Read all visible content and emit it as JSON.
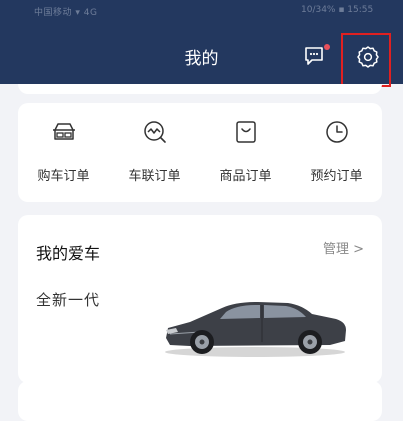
{
  "status_bar": {
    "left_text": "中国移动 ▾ 4G",
    "right_text": "10/34% ▪ 15:55"
  },
  "header": {
    "title": "我的"
  },
  "icons": {
    "message": "message-icon",
    "settings": "gear-icon",
    "car_order": "car-icon",
    "connected_order": "connected-car-icon",
    "goods_order": "shopping-bag-icon",
    "appointment_order": "clock-icon",
    "manage_chevron": "chevron-right-icon"
  },
  "colors": {
    "header_bg": "#23385f",
    "page_bg": "#f2f3f7",
    "highlight": "#e02020",
    "badge": "#e8505b"
  },
  "orders": [
    {
      "label": "购车订单"
    },
    {
      "label": "车联订单"
    },
    {
      "label": "商品订单"
    },
    {
      "label": "预约订单"
    }
  ],
  "my_car": {
    "title": "我的爱车",
    "manage_label": "管理 >",
    "model": "全新一代"
  }
}
